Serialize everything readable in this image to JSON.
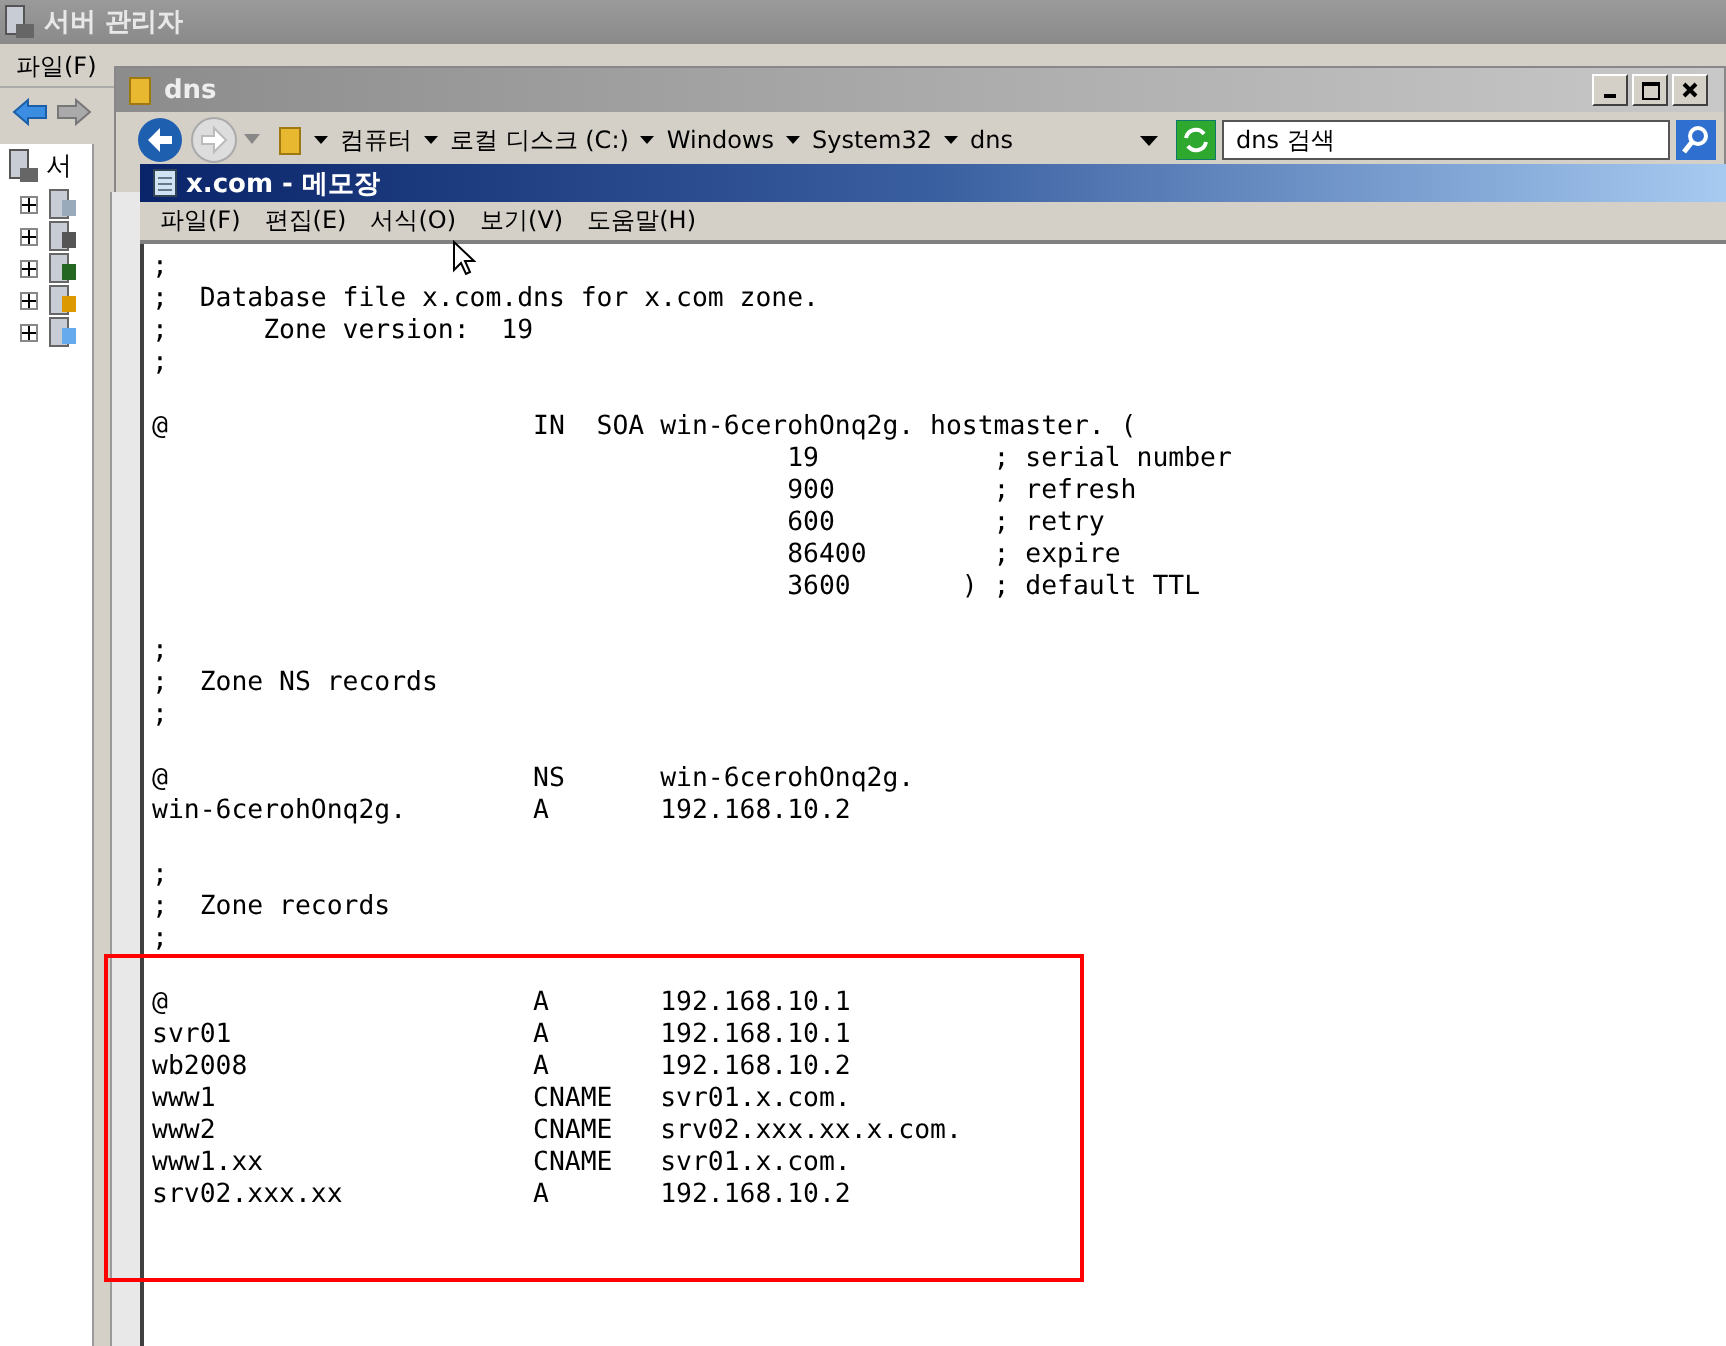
{
  "server_manager": {
    "title": "서버 관리자",
    "menu": [
      "파일(F)"
    ],
    "tree_root": "서",
    "tree_items": [
      {
        "expanded": false
      },
      {
        "expanded": false
      },
      {
        "expanded": false
      },
      {
        "expanded": false
      },
      {
        "expanded": false
      }
    ]
  },
  "explorer": {
    "title": "dns",
    "breadcrumbs": [
      "컴퓨터",
      "로컬 디스크 (C:)",
      "Windows",
      "System32",
      "dns"
    ],
    "search": {
      "placeholder": "dns 검색"
    }
  },
  "notepad": {
    "title": "x.com - 메모장",
    "menu": [
      "파일(F)",
      "편집(E)",
      "서식(O)",
      "보기(V)",
      "도움말(H)"
    ],
    "content": ";\n;  Database file x.com.dns for x.com zone.\n;      Zone version:  19\n;\n\n@                       IN  SOA win-6cerohOnq2g. hostmaster. (\n                                        19           ; serial number\n                                        900          ; refresh\n                                        600          ; retry\n                                        86400        ; expire\n                                        3600       ) ; default TTL\n\n;\n;  Zone NS records\n;\n\n@                       NS      win-6cerohOnq2g.\nwin-6cerohOnq2g.        A       192.168.10.2\n\n;\n;  Zone records\n;\n\n@                       A       192.168.10.1\nsvr01                   A       192.168.10.1\nwb2008                  A       192.168.10.2\nwww1                    CNAME   svr01.x.com.\nwww2                    CNAME   srv02.xxx.xx.x.com.\nwww1.xx                 CNAME   svr01.x.com.\nsrv02.xxx.xx            A       192.168.10.2"
  }
}
